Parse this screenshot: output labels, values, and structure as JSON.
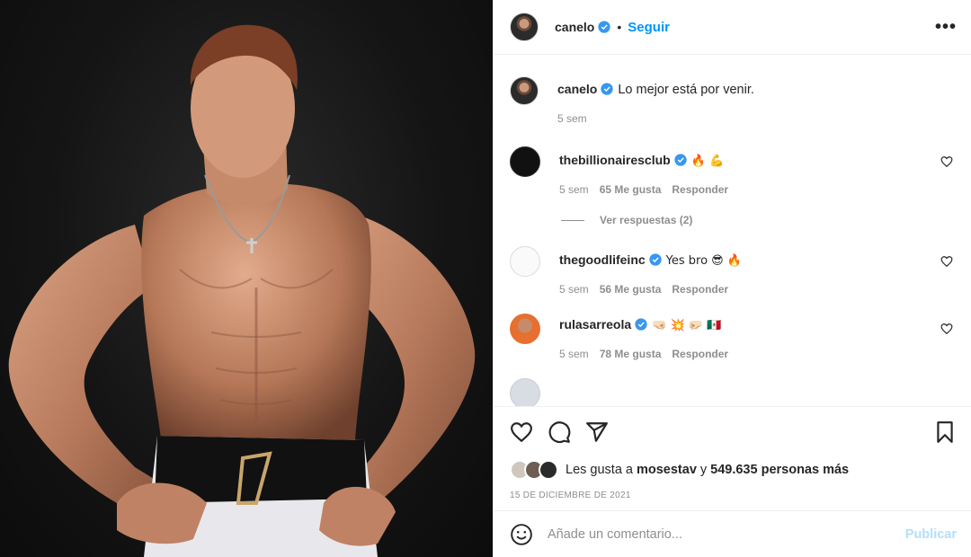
{
  "post": {
    "author": "canelo",
    "follow_label": "Seguir",
    "more_label": "•••",
    "caption": "Lo mejor está por venir.",
    "caption_time": "5 sem"
  },
  "comments": [
    {
      "user": "thebillionairesclub",
      "text": "🔥 💪",
      "time": "5 sem",
      "likes": "65 Me gusta",
      "reply": "Responder",
      "replies_label": "Ver respuestas (2)"
    },
    {
      "user": "thegoodlifeinc",
      "text": "Yes bro 😎 🔥",
      "time": "5 sem",
      "likes": "56 Me gusta",
      "reply": "Responder"
    },
    {
      "user": "rulasarreola",
      "text": "🤜🏻 💥 🤛🏻 🇲🇽",
      "time": "5 sem",
      "likes": "78 Me gusta",
      "reply": "Responder"
    }
  ],
  "likes": {
    "prefix": "Les gusta a",
    "user": "mosestav",
    "joiner": "y",
    "others": "549.635 personas más"
  },
  "date": "15 de diciembre de 2021",
  "add_comment": {
    "placeholder": "Añade un comentario...",
    "publish_label": "Publicar"
  },
  "colors": {
    "accent": "#0095f6",
    "publish_disabled": "#b2dffc",
    "muted": "#8e8e8e",
    "text": "#262626"
  },
  "icons": [
    "verified-badge-icon",
    "more-options-icon",
    "heart-icon",
    "comment-icon",
    "share-icon",
    "bookmark-icon",
    "smiley-icon"
  ]
}
